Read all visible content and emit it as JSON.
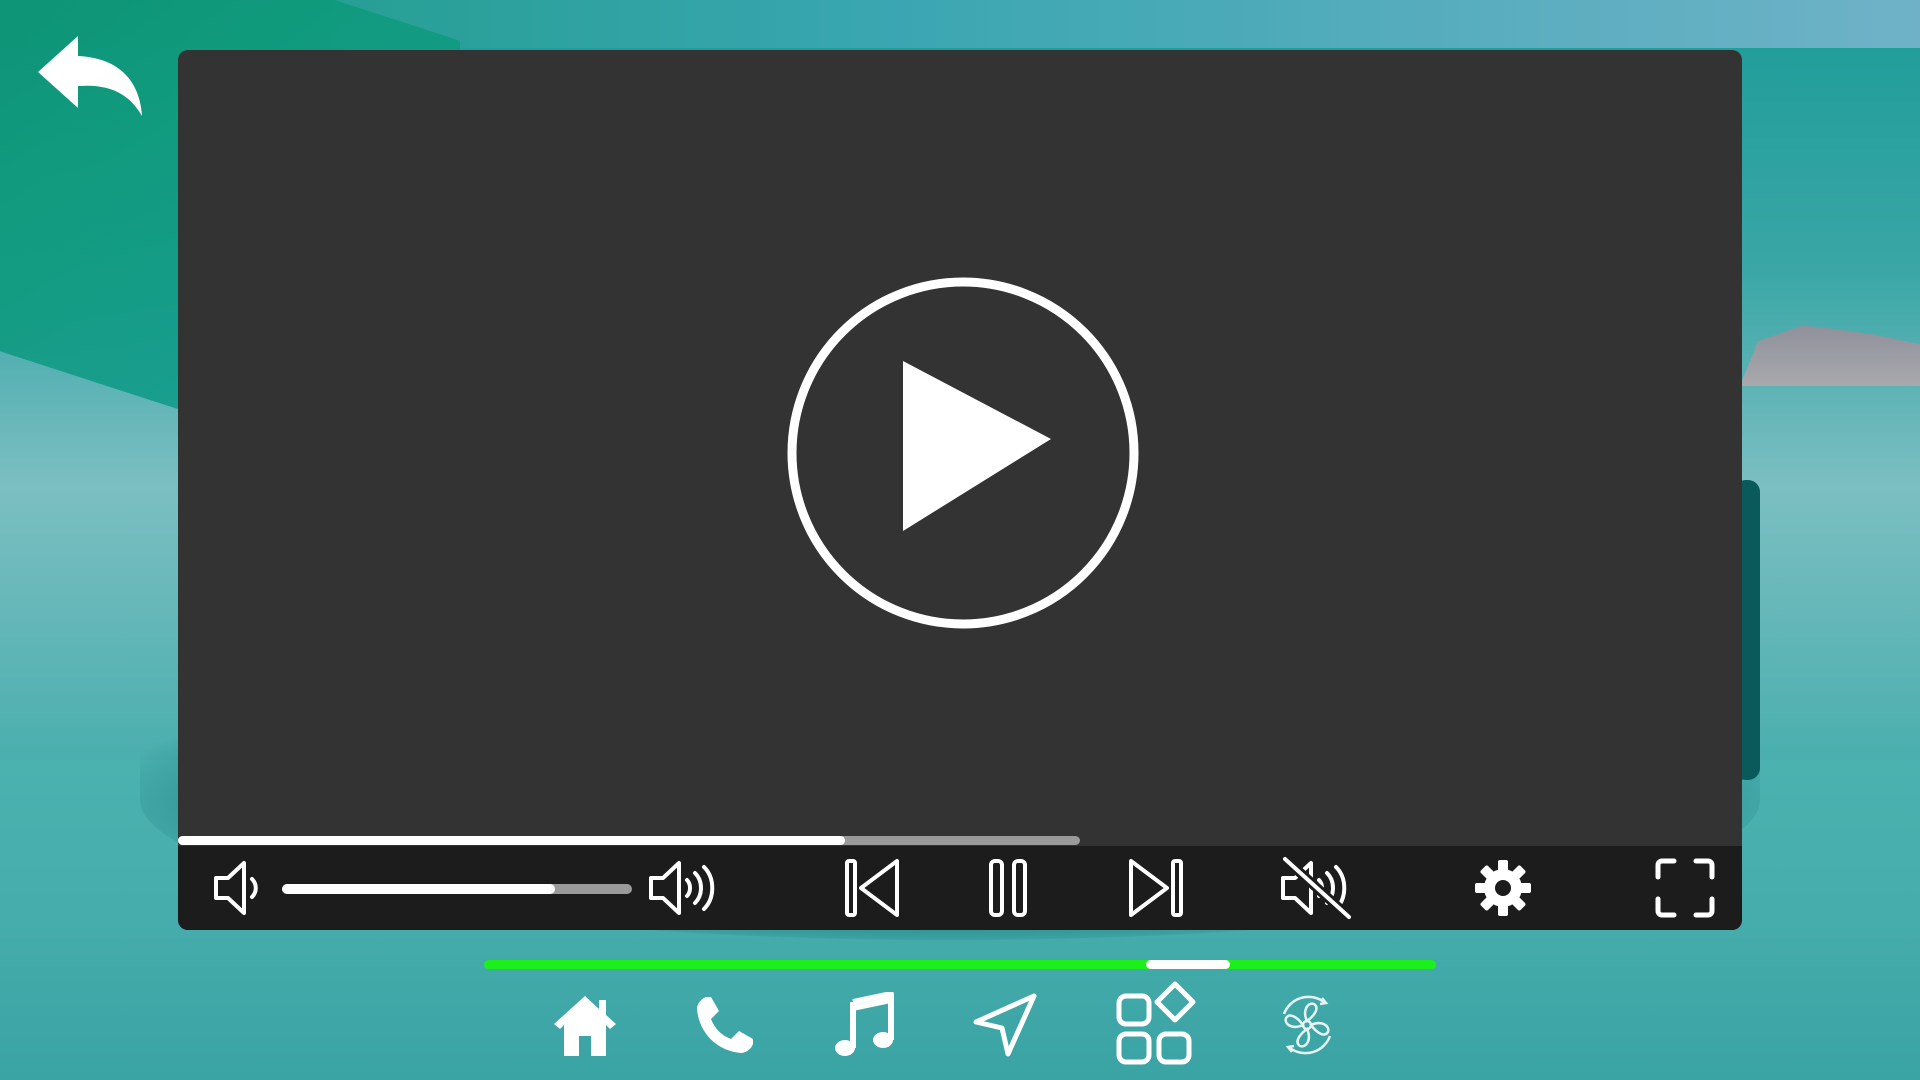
{
  "app": {
    "background": "car-road-teal-photo"
  },
  "nav": {
    "back_icon": "back-arrow-icon"
  },
  "player": {
    "big_play_icon": "play-circle-icon",
    "playback_progress": 0.74,
    "volume_level": 0.78,
    "controls": [
      {
        "id": "volume-down",
        "icon": "volume-low-icon"
      },
      {
        "id": "volume-up",
        "icon": "volume-high-icon"
      },
      {
        "id": "previous",
        "icon": "skip-previous-icon"
      },
      {
        "id": "pause",
        "icon": "pause-icon"
      },
      {
        "id": "next",
        "icon": "skip-next-icon"
      },
      {
        "id": "mute",
        "icon": "volume-mute-icon"
      },
      {
        "id": "settings",
        "icon": "gear-icon"
      },
      {
        "id": "fullscreen",
        "icon": "fullscreen-icon"
      }
    ]
  },
  "pager": {
    "current_page_fraction": 0.74,
    "active_color": "#1cf01c"
  },
  "dock": {
    "items": [
      {
        "id": "home",
        "icon": "home-icon"
      },
      {
        "id": "phone",
        "icon": "phone-icon"
      },
      {
        "id": "music",
        "icon": "music-note-icon"
      },
      {
        "id": "navigation",
        "icon": "navigation-arrow-icon"
      },
      {
        "id": "apps",
        "icon": "apps-grid-icon"
      },
      {
        "id": "climate",
        "icon": "fan-icon"
      }
    ]
  }
}
